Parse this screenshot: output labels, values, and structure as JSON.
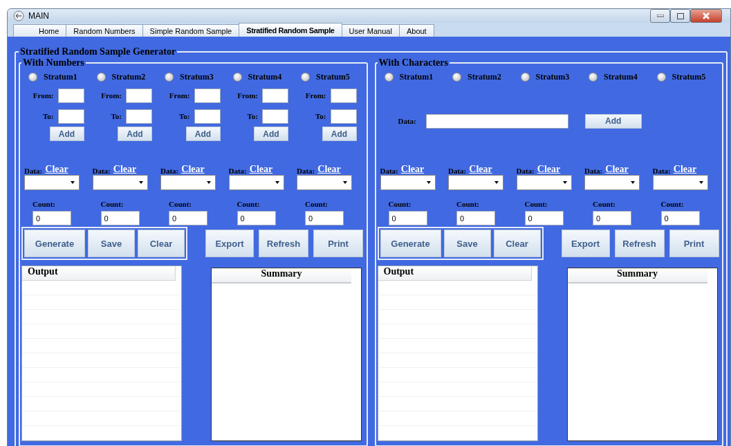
{
  "window": {
    "title": "MAIN"
  },
  "tabs": [
    {
      "label": "Home",
      "selected": false
    },
    {
      "label": "Random Numbers",
      "selected": false
    },
    {
      "label": "Simple Random Sample",
      "selected": false
    },
    {
      "label": "Stratified Random Sample",
      "selected": true
    },
    {
      "label": "User Manual",
      "selected": false
    },
    {
      "label": "About",
      "selected": false
    }
  ],
  "generator": {
    "title": "Stratified Random Sample Generator",
    "panels": [
      {
        "kind": "numbers",
        "title": "With Numbers",
        "strata": [
          {
            "label": "Stratum1",
            "selected": false
          },
          {
            "label": "Stratum2",
            "selected": false
          },
          {
            "label": "Stratum3",
            "selected": false
          },
          {
            "label": "Stratum4",
            "selected": false
          },
          {
            "label": "Stratum5",
            "selected": false
          }
        ],
        "ranges": [
          {
            "from_label": "From:",
            "to_label": "To:",
            "add": "Add"
          },
          {
            "from_label": "From:",
            "to_label": "To:",
            "add": "Add"
          },
          {
            "from_label": "From:",
            "to_label": "To:",
            "add": "Add"
          },
          {
            "from_label": "From:",
            "to_label": "To:",
            "add": "Add"
          },
          {
            "from_label": "From:",
            "to_label": "To:",
            "add": "Add"
          }
        ],
        "data_columns": [
          {
            "label": "Data:",
            "clear": "Clear",
            "count_label": "Count:",
            "count": "0"
          },
          {
            "label": "Data:",
            "clear": "Clear",
            "count_label": "Count:",
            "count": "0"
          },
          {
            "label": "Data:",
            "clear": "Clear",
            "count_label": "Count:",
            "count": "0"
          },
          {
            "label": "Data:",
            "clear": "Clear",
            "count_label": "Count:",
            "count": "0"
          },
          {
            "label": "Data:",
            "clear": "Clear",
            "count_label": "Count:",
            "count": "0"
          }
        ],
        "grouped_buttons": [
          "Generate",
          "Save",
          "Clear"
        ],
        "buttons": [
          "Export",
          "Refresh",
          "Print"
        ],
        "output": {
          "header": "Output"
        },
        "summary": {
          "header": "Summary"
        }
      },
      {
        "kind": "characters",
        "title": "With Characters",
        "strata": [
          {
            "label": "Stratum1",
            "selected": false
          },
          {
            "label": "Stratum2",
            "selected": false
          },
          {
            "label": "Stratum3",
            "selected": false
          },
          {
            "label": "Stratum4",
            "selected": false
          },
          {
            "label": "Stratum5",
            "selected": false
          }
        ],
        "data_entry": {
          "label": "Data:",
          "add": "Add"
        },
        "data_columns": [
          {
            "label": "Data:",
            "clear": "Clear",
            "count_label": "Count:",
            "count": "0"
          },
          {
            "label": "Data:",
            "clear": "Clear",
            "count_label": "Count:",
            "count": "0"
          },
          {
            "label": "Data:",
            "clear": "Clear",
            "count_label": "Count:",
            "count": "0"
          },
          {
            "label": "Data:",
            "clear": "Clear",
            "count_label": "Count:",
            "count": "0"
          },
          {
            "label": "Data:",
            "clear": "Clear",
            "count_label": "Count:",
            "count": "0"
          }
        ],
        "grouped_buttons": [
          "Generate",
          "Save",
          "Clear"
        ],
        "buttons": [
          "Export",
          "Refresh",
          "Print"
        ],
        "output": {
          "header": "Output"
        },
        "summary": {
          "header": "Summary"
        }
      }
    ]
  }
}
